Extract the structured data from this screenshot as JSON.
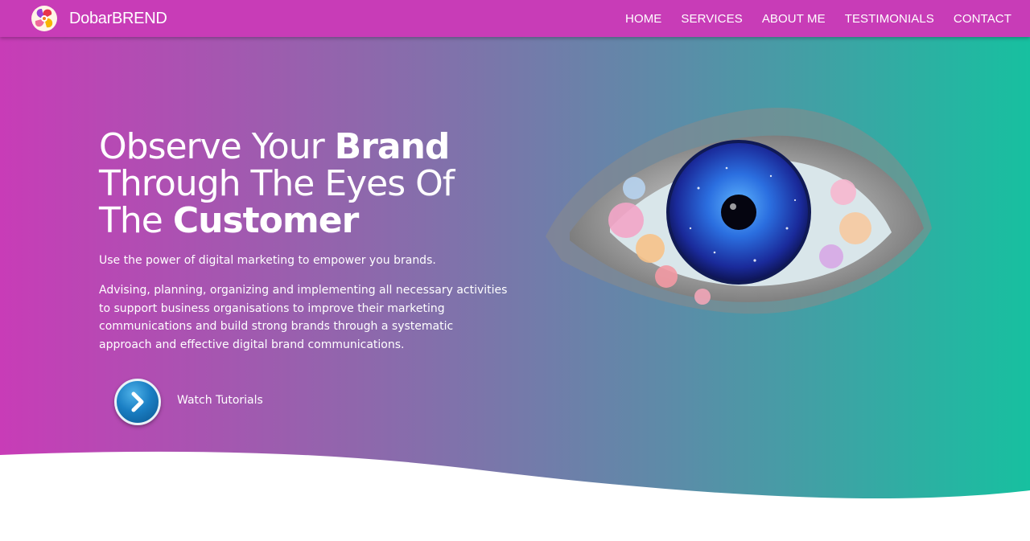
{
  "brand": {
    "name": "DobarBREND",
    "logo_icon": "swirl-logo-icon"
  },
  "nav": {
    "items": [
      {
        "label": "HOME"
      },
      {
        "label": "SERVICES"
      },
      {
        "label": "ABOUT ME"
      },
      {
        "label": "TESTIMONIALS"
      },
      {
        "label": "CONTACT"
      }
    ]
  },
  "hero": {
    "title_part1": "Observe Your ",
    "title_bold1": "Brand",
    "title_part2": " Through The Eyes Of The ",
    "title_bold2": "Customer",
    "subtitle": "Use the power of digital marketing to empower you brands.",
    "description": "Advising, planning, organizing and implementing all necessary activities to support business organisations to improve their marketing communications and build strong brands through a systematic approach and effective digital brand communications.",
    "cta_label": "Watch Tutorials",
    "cta_icon": "chevron-right-icon",
    "illustration": "eye-illustration"
  },
  "colors": {
    "nav_bg": "#c83cb7",
    "gradient_start": "#c83cb7",
    "gradient_end": "#17c0a0",
    "cta_blue": "#1a7fc4",
    "text": "#ffffff"
  }
}
